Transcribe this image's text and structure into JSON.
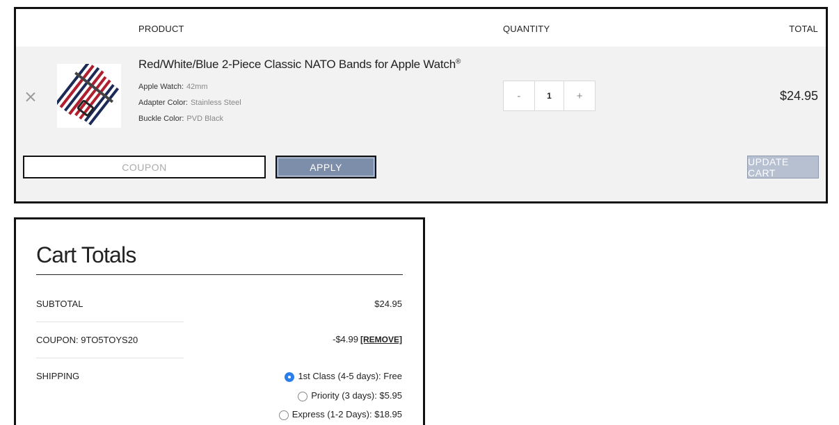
{
  "cart": {
    "headers": {
      "product": "PRODUCT",
      "quantity": "QUANTITY",
      "total": "TOTAL"
    },
    "item": {
      "title": "Red/White/Blue 2-Piece Classic NATO Bands for Apple Watch",
      "title_mark": "®",
      "meta": [
        {
          "key": "Apple Watch:",
          "value": "42mm"
        },
        {
          "key": "Adapter Color:",
          "value": "Stainless Steel"
        },
        {
          "key": "Buckle Color:",
          "value": "PVD Black"
        }
      ],
      "quantity": "1",
      "decrement": "-",
      "increment": "+",
      "line_total": "$24.95"
    },
    "coupon": {
      "placeholder": "COUPON",
      "value": ""
    },
    "apply_label": "APPLY",
    "update_label": "UPDATE CART",
    "colors": {
      "apply_bg": "#7d8eab",
      "update_bg": "#b7c0d1",
      "body_bg": "#f2f2f2"
    }
  },
  "totals": {
    "title": "Cart Totals",
    "subtotal_label": "SUBTOTAL",
    "subtotal_value": "$24.95",
    "coupon_label": "COUPON: 9TO5TOYS20",
    "coupon_value": "-$4.99",
    "coupon_remove": "[REMOVE]",
    "shipping_label": "SHIPPING",
    "shipping_options": [
      {
        "label": "1st Class (4-5 days): Free",
        "selected": true
      },
      {
        "label": "Priority (3 days): $5.95",
        "selected": false
      },
      {
        "label": "Express (1-2 Days): $18.95",
        "selected": false
      }
    ],
    "colors": {
      "radio_selected": "#2b7de9"
    }
  }
}
